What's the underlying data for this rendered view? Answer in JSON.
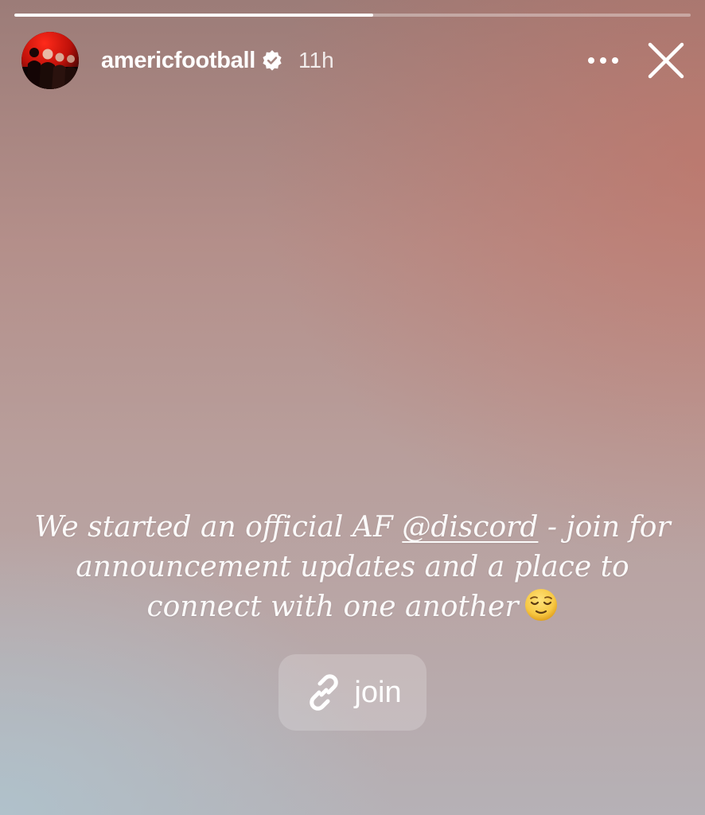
{
  "story": {
    "progress_fraction": 0.53,
    "account": {
      "username": "americfootball",
      "verified": true,
      "posted_ago": "11h",
      "avatar_icon": "band-photo-avatar"
    },
    "controls": {
      "more_icon": "more-horizontal-icon",
      "close_icon": "close-icon"
    },
    "caption": {
      "before_mention": "We started an official AF ",
      "mention": "@discord",
      "after_mention": " - join for announcement updates and a place to connect with one another",
      "emoji": "relieved-face-emoji"
    },
    "link_sticker": {
      "label": "join",
      "icon": "link-icon"
    }
  },
  "colors": {
    "accent_white": "#ffffff",
    "emoji_yellow": "#f7c844"
  }
}
